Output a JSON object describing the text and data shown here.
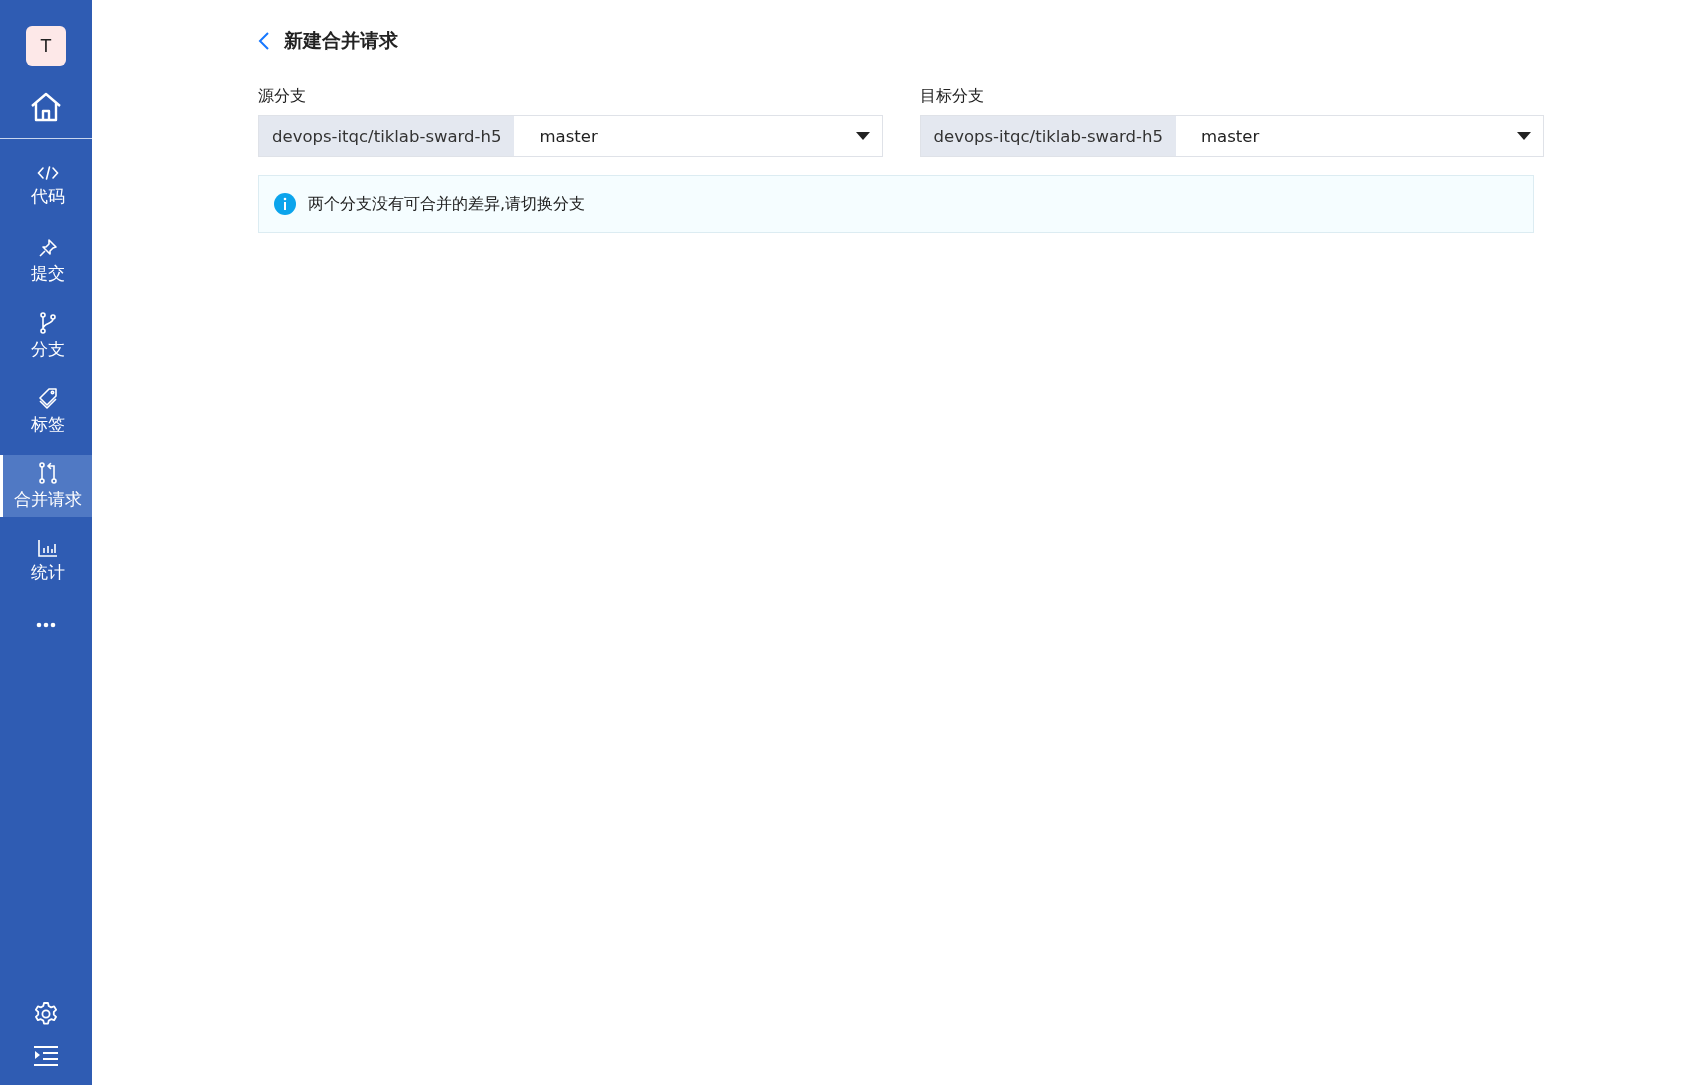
{
  "sidebar": {
    "avatar": "T",
    "nav_items": [
      {
        "label": "代码",
        "kind": "code",
        "selected": false
      },
      {
        "label": "提交",
        "kind": "pin",
        "selected": false
      },
      {
        "label": "分支",
        "kind": "branch",
        "selected": false
      },
      {
        "label": "标签",
        "kind": "tag",
        "selected": false
      },
      {
        "label": "合并请求",
        "kind": "merge",
        "selected": true
      },
      {
        "label": "统计",
        "kind": "chart",
        "selected": false
      }
    ]
  },
  "page": {
    "title": "新建合并请求",
    "pickers": [
      {
        "label": "源分支",
        "repo": "devops-itqc/tiklab-sward-h5",
        "branch": "master"
      },
      {
        "label": "目标分支",
        "repo": "devops-itqc/tiklab-sward-h5",
        "branch": "master"
      }
    ],
    "alert": {
      "message": "两个分支没有可合并的差异,请切换分支"
    }
  }
}
